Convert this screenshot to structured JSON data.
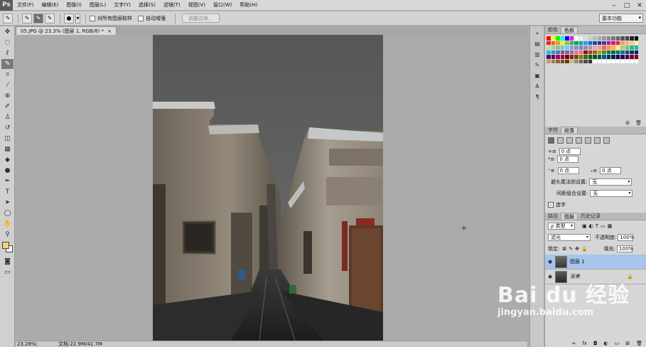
{
  "app": {
    "logo": "Ps"
  },
  "menu": [
    "文件(F)",
    "编辑(E)",
    "图像(I)",
    "图层(L)",
    "文字(Y)",
    "选择(S)",
    "滤镜(T)",
    "视图(V)",
    "窗口(W)",
    "帮助(H)"
  ],
  "window_controls": [
    "‒",
    "□",
    "✕"
  ],
  "options": {
    "sample_all_layers": "对所有图层取样",
    "auto_enhance": "自动增强",
    "refine_edge": "调整边缘...",
    "workspace": "基本功能"
  },
  "document": {
    "tab_title": "05.JPG @ 23.3% (图层 1, RGB/8) *",
    "close": "×"
  },
  "status": {
    "zoom": "23.28%",
    "doc_info": "文档:22.9M/41.7M"
  },
  "panels": {
    "color_tabs": [
      "颜色",
      "色板"
    ],
    "char_tabs": [
      "字符",
      "段落"
    ],
    "paragraph": {
      "indent_left": "0 点",
      "indent_right": "0 点",
      "first_line": "0 点",
      "space_before": "0 点",
      "space_after": "0 点",
      "kinsoku_label": "避头尾法则设置:",
      "kinsoku_value": "无",
      "mojikumi_label": "间距组合设置:",
      "mojikumi_value": "无",
      "hyphenate": "连字"
    },
    "layer_tabs": [
      "路径",
      "图层",
      "历史记录"
    ],
    "layers": {
      "filter_kind": "ρ 类型",
      "blend_mode": "滤光",
      "opacity_label": "不透明度:",
      "opacity_value": "100%",
      "lock_label": "锁定:",
      "fill_label": "填充:",
      "fill_value": "100%",
      "items": [
        {
          "name": "图层 1",
          "selected": true
        },
        {
          "name": "背景",
          "selected": false
        }
      ]
    }
  },
  "watermark": {
    "line1": "Bai du 经验",
    "line2": "jingyan.baidu.com"
  },
  "colors": {
    "foreground": "#f4d27a",
    "background": "#ffffff",
    "selected_layer": "#a6c4ec"
  }
}
